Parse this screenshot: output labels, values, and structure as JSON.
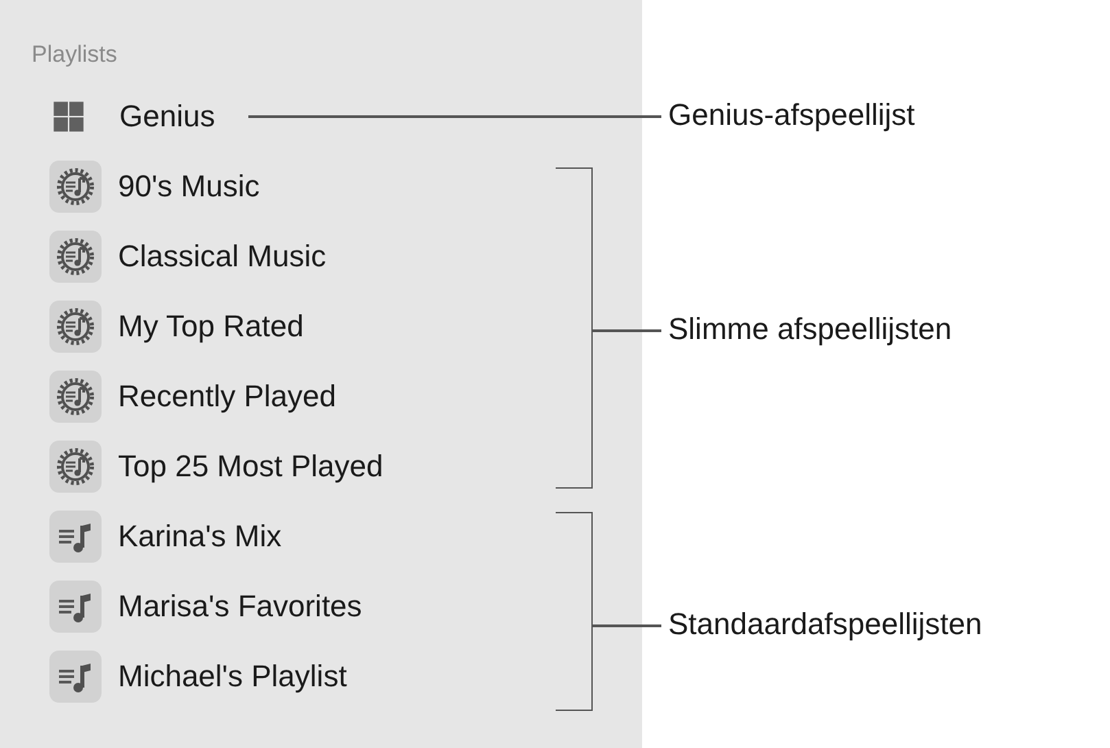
{
  "sidebar": {
    "heading": "Playlists",
    "items": [
      {
        "kind": "genius",
        "label": "Genius"
      },
      {
        "kind": "smart",
        "label": "90's Music"
      },
      {
        "kind": "smart",
        "label": "Classical Music"
      },
      {
        "kind": "smart",
        "label": "My Top Rated"
      },
      {
        "kind": "smart",
        "label": "Recently Played"
      },
      {
        "kind": "smart",
        "label": "Top 25 Most Played"
      },
      {
        "kind": "standard",
        "label": "Karina's Mix"
      },
      {
        "kind": "standard",
        "label": "Marisa's Favorites"
      },
      {
        "kind": "standard",
        "label": "Michael's Playlist"
      }
    ]
  },
  "callouts": [
    {
      "kind": "line",
      "label": "Genius-afspeellijst"
    },
    {
      "kind": "bracket",
      "label": "Slimme afspeellijsten"
    },
    {
      "kind": "bracket",
      "label": "Standaardafspeellijsten"
    }
  ]
}
